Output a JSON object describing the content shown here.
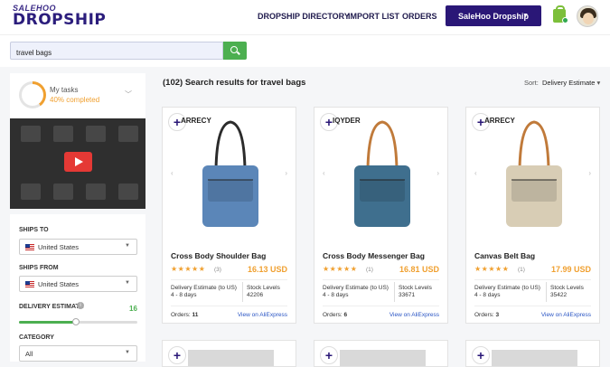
{
  "header": {
    "logo_top": "SALEHOO",
    "logo_bottom": "DROPSHIP",
    "nav": [
      "DROPSHIP DIRECTORY",
      "IMPORT LIST",
      "ORDERS"
    ],
    "account_button": "SaleHoo Dropship",
    "brand_color": "#2a1777",
    "accent_color": "#4caf50"
  },
  "search": {
    "value": "travel bags"
  },
  "tasks": {
    "title": "My tasks",
    "progress_label": "40% completed",
    "progress": 0.4
  },
  "filters": {
    "ships_to_label": "SHIPS TO",
    "ships_to_value": "United States",
    "ships_from_label": "SHIPS FROM",
    "ships_from_value": "United States",
    "delivery_label": "DELIVERY ESTIMATE",
    "delivery_value": "16",
    "delivery_fraction": 0.48,
    "category_label": "CATEGORY",
    "category_value": "All"
  },
  "results": {
    "title": "(102) Search results for travel bags",
    "sort_label": "Sort:",
    "sort_value": "Delivery Estimate"
  },
  "products": [
    {
      "brand": "ARRECY",
      "name": "Cross Body Shoulder Bag",
      "rating": 5,
      "reviews": "(3)",
      "price": "16.13 USD",
      "delivery_label": "Delivery Estimate (to US)",
      "delivery_value": "4 - 8 days",
      "stock_label": "Stock Levels",
      "stock_value": "42206",
      "orders_label": "Orders:",
      "orders_value": "11",
      "link": "View on AliExpress",
      "bag_color": "#5b86b8"
    },
    {
      "brand": "IQYDER",
      "name": "Cross Body Messenger Bag",
      "rating": 5,
      "reviews": "(1)",
      "price": "16.81 USD",
      "delivery_label": "Delivery Estimate (to US)",
      "delivery_value": "4 - 8 days",
      "stock_label": "Stock Levels",
      "stock_value": "33671",
      "orders_label": "Orders:",
      "orders_value": "6",
      "link": "View on AliExpress",
      "bag_color": "#3f6f8e"
    },
    {
      "brand": "ARRECY",
      "name": "Canvas Belt Bag",
      "rating": 5,
      "reviews": "(1)",
      "price": "17.99 USD",
      "delivery_label": "Delivery Estimate (to US)",
      "delivery_value": "4 - 8 days",
      "stock_label": "Stock Levels",
      "stock_value": "35422",
      "orders_label": "Orders:",
      "orders_value": "3",
      "link": "View on AliExpress",
      "bag_color": "#d8cdb5"
    }
  ]
}
